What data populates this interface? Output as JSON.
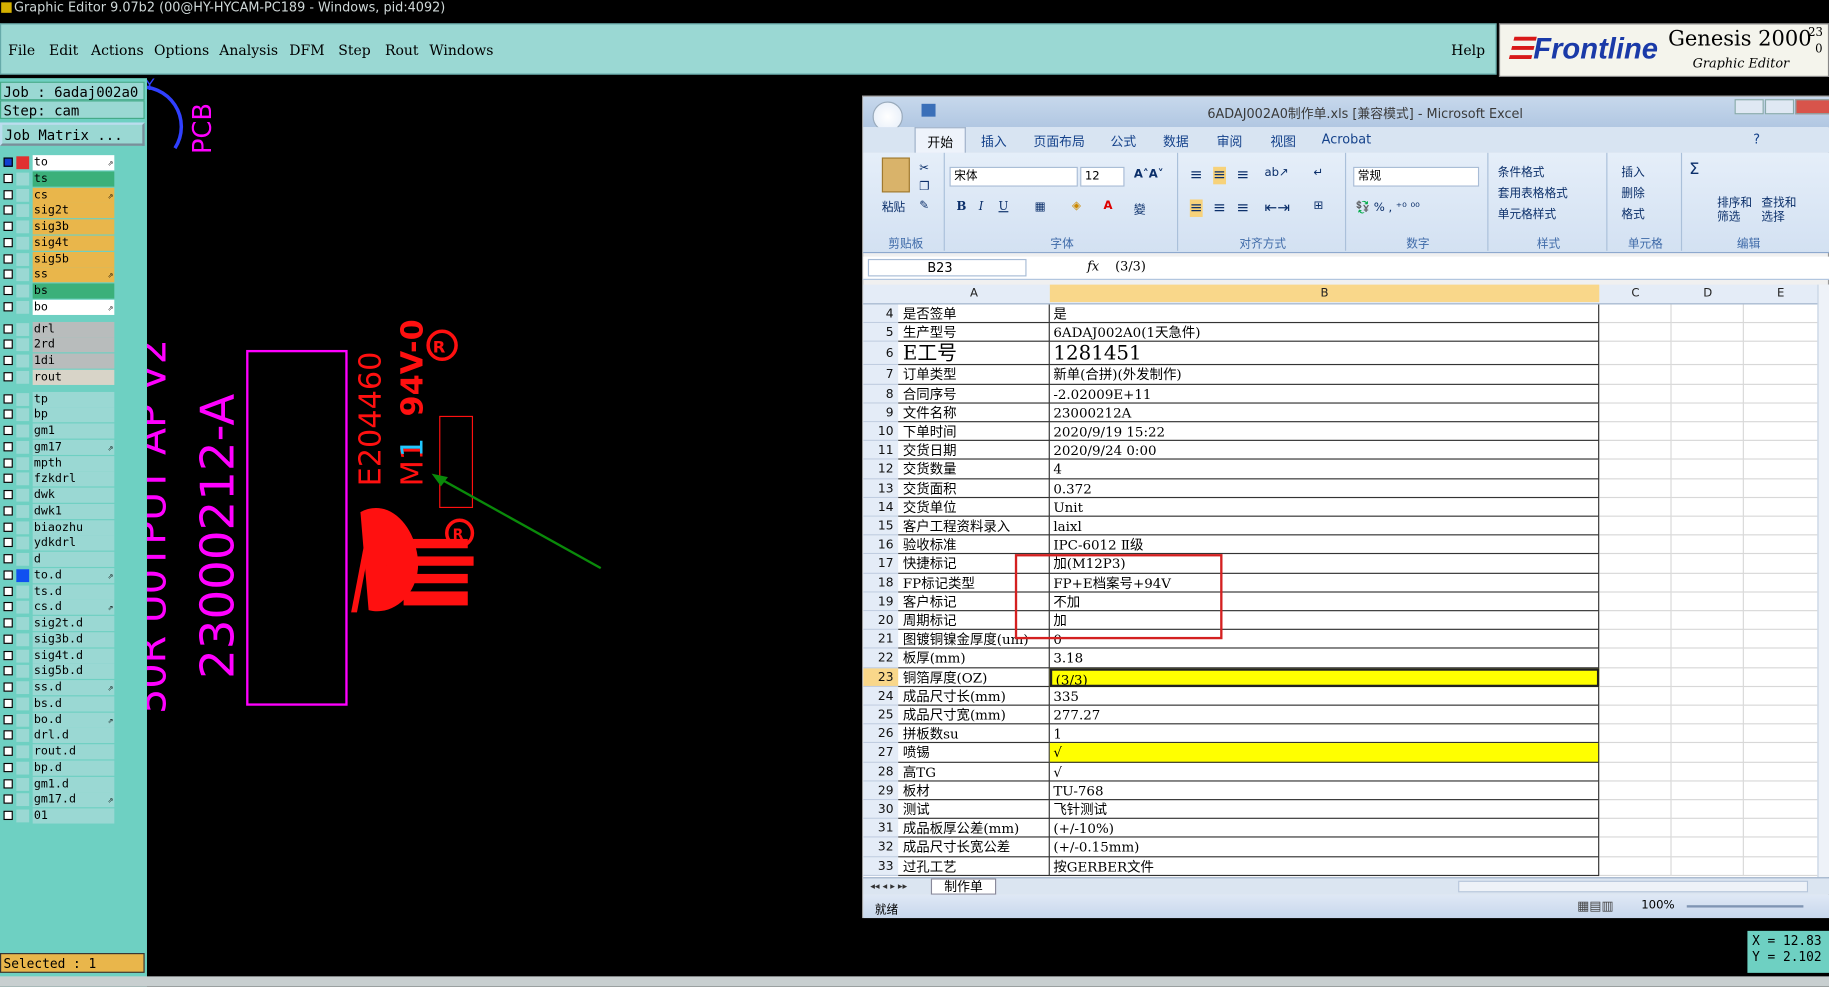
{
  "genesis": {
    "title": "Graphic Editor 9.07b2 (00@HY-HYCAM-PC189 - Windows, pid:4092)",
    "menu": [
      "File",
      "Edit",
      "Actions",
      "Options",
      "Analysis",
      "DFM",
      "Step",
      "Rout",
      "Windows"
    ],
    "help": "Help",
    "brand": {
      "frontline": "Frontline",
      "genesis": "Genesis 2000",
      "editor": "Graphic Editor",
      "version_top": "23",
      "version_bottom": "0"
    },
    "job": "Job : 6adaj002a0",
    "step": "Step: cam",
    "job_matrix": "Job Matrix ...",
    "layers": [
      {
        "name": "to",
        "color": "#ffffff",
        "arrow": "⇗"
      },
      {
        "name": "ts",
        "color": "#3bb07a",
        "arrow": ""
      },
      {
        "name": "cs",
        "color": "#e9b64b",
        "arrow": "⇗"
      },
      {
        "name": "sig2t",
        "color": "#e9b64b",
        "arrow": ""
      },
      {
        "name": "sig3b",
        "color": "#e9b64b",
        "arrow": ""
      },
      {
        "name": "sig4t",
        "color": "#e9b64b",
        "arrow": ""
      },
      {
        "name": "sig5b",
        "color": "#e9b64b",
        "arrow": ""
      },
      {
        "name": "ss",
        "color": "#e9b64b",
        "arrow": "⇗"
      },
      {
        "name": "bs",
        "color": "#3bb07a",
        "arrow": ""
      },
      {
        "name": "bo",
        "color": "#ffffff",
        "arrow": "⇗"
      },
      {
        "name": "drl",
        "color": "#b8bcbc",
        "arrow": ""
      },
      {
        "name": "2rd",
        "color": "#b8bcbc",
        "arrow": ""
      },
      {
        "name": "1di",
        "color": "#b8bcbc",
        "arrow": ""
      },
      {
        "name": "rout",
        "color": "#d8d4c8",
        "arrow": ""
      },
      {
        "name": "tp",
        "color": "#9ad8d3",
        "arrow": ""
      },
      {
        "name": "bp",
        "color": "#9ad8d3",
        "arrow": ""
      },
      {
        "name": "gm1",
        "color": "#9ad8d3",
        "arrow": ""
      },
      {
        "name": "gm17",
        "color": "#9ad8d3",
        "arrow": "⇗"
      },
      {
        "name": "mpth",
        "color": "#9ad8d3",
        "arrow": ""
      },
      {
        "name": "fzkdrl",
        "color": "#9ad8d3",
        "arrow": ""
      },
      {
        "name": "dwk",
        "color": "#9ad8d3",
        "arrow": ""
      },
      {
        "name": "dwk1",
        "color": "#9ad8d3",
        "arrow": ""
      },
      {
        "name": "biaozhu",
        "color": "#9ad8d3",
        "arrow": ""
      },
      {
        "name": "ydkdrl",
        "color": "#9ad8d3",
        "arrow": ""
      },
      {
        "name": "d",
        "color": "#9ad8d3",
        "arrow": ""
      },
      {
        "name": "to.d",
        "color": "#9ad8d3",
        "arrow": "⇗"
      },
      {
        "name": "ts.d",
        "color": "#9ad8d3",
        "arrow": ""
      },
      {
        "name": "cs.d",
        "color": "#9ad8d3",
        "arrow": "⇗"
      },
      {
        "name": "sig2t.d",
        "color": "#9ad8d3",
        "arrow": ""
      },
      {
        "name": "sig3b.d",
        "color": "#9ad8d3",
        "arrow": ""
      },
      {
        "name": "sig4t.d",
        "color": "#9ad8d3",
        "arrow": ""
      },
      {
        "name": "sig5b.d",
        "color": "#9ad8d3",
        "arrow": ""
      },
      {
        "name": "ss.d",
        "color": "#9ad8d3",
        "arrow": "⇗"
      },
      {
        "name": "bs.d",
        "color": "#9ad8d3",
        "arrow": ""
      },
      {
        "name": "bo.d",
        "color": "#9ad8d3",
        "arrow": "⇗"
      },
      {
        "name": "drl.d",
        "color": "#9ad8d3",
        "arrow": ""
      },
      {
        "name": "rout.d",
        "color": "#9ad8d3",
        "arrow": ""
      },
      {
        "name": "bp.d",
        "color": "#9ad8d3",
        "arrow": ""
      },
      {
        "name": "gm1.d",
        "color": "#9ad8d3",
        "arrow": ""
      },
      {
        "name": "gm17.d",
        "color": "#9ad8d3",
        "arrow": "⇗"
      },
      {
        "name": "01",
        "color": "#9ad8d3",
        "arrow": ""
      }
    ],
    "selected": "Selected : 1",
    "coords": {
      "x": "X = 12.83",
      "y": "Y = 2.102"
    },
    "canvas": {
      "pcb": "PCB",
      "job_text": "23000212-A",
      "partial_text": "50R U0TPUT AP V2",
      "ul": "E204460",
      "grade": "94V-0",
      "date_code_a": "M1",
      "date_code_b": "1"
    }
  },
  "excel": {
    "title": "6ADAJ002A0制作单.xls [兼容模式] - Microsoft Excel",
    "tabs": [
      "开始",
      "插入",
      "页面布局",
      "公式",
      "数据",
      "审阅",
      "视图",
      "Acrobat"
    ],
    "ribbon": {
      "paste": "粘贴",
      "clipboard": "剪贴板",
      "font": "宋体",
      "size": "12",
      "font_group": "字体",
      "align_group": "对齐方式",
      "number_format": "常规",
      "number_group": "数字",
      "styles": [
        "条件格式",
        "套用表格格式",
        "单元格样式"
      ],
      "styles_group": "样式",
      "cells": [
        "插入",
        "删除",
        "格式"
      ],
      "cells_group": "单元格",
      "sort": "排序和\n筛选",
      "find": "查找和\n选择",
      "edit_group": "编辑"
    },
    "namebox": "B23",
    "fx": "fx",
    "formula": " (3/3)",
    "columns": [
      "A",
      "B",
      "C",
      "D",
      "E"
    ],
    "rows": [
      {
        "n": "4",
        "a": "是否签单",
        "b": "是",
        "hl": false
      },
      {
        "n": "5",
        "a": "生产型号",
        "b": "6ADAJ002A0(1天急件)",
        "hl": false
      },
      {
        "n": "6",
        "a": "E工号",
        "b": "1281451",
        "hl": false,
        "big": true
      },
      {
        "n": "7",
        "a": "订单类型",
        "b": "新单(合拼)(外发制作)",
        "hl": false
      },
      {
        "n": "8",
        "a": "合同序号",
        "b": "-2.02009E+11",
        "hl": false
      },
      {
        "n": "9",
        "a": "文件名称",
        "b": "23000212A",
        "hl": false
      },
      {
        "n": "10",
        "a": "下单时间",
        "b": "2020/9/19 15:22",
        "hl": false
      },
      {
        "n": "11",
        "a": "交货日期",
        "b": "2020/9/24 0:00",
        "hl": false
      },
      {
        "n": "12",
        "a": "交货数量",
        "b": "4",
        "hl": false
      },
      {
        "n": "13",
        "a": "交货面积",
        "b": "0.372",
        "hl": false
      },
      {
        "n": "14",
        "a": "交货单位",
        "b": "Unit",
        "hl": false
      },
      {
        "n": "15",
        "a": "客户工程资料录入",
        "b": "laixl",
        "hl": false
      },
      {
        "n": "16",
        "a": "验收标准",
        "b": "IPC-6012 Ⅱ级",
        "hl": false
      },
      {
        "n": "17",
        "a": "快捷标记",
        "b": "加(M12P3)",
        "hl": false
      },
      {
        "n": "18",
        "a": "FP标记类型",
        "b": "FP+E档案号+94V",
        "hl": false
      },
      {
        "n": "19",
        "a": "客户标记",
        "b": "不加",
        "hl": false
      },
      {
        "n": "20",
        "a": "周期标记",
        "b": "加",
        "hl": false
      },
      {
        "n": "21",
        "a": "图镀铜镍金厚度(um)",
        "b": "0",
        "hl": false
      },
      {
        "n": "22",
        "a": "板厚(mm)",
        "b": "3.18",
        "hl": false
      },
      {
        "n": "23",
        "a": "铜箔厚度(OZ)",
        "b": " (3/3)",
        "hl": true
      },
      {
        "n": "24",
        "a": "成品尺寸长(mm)",
        "b": "335",
        "hl": false
      },
      {
        "n": "25",
        "a": "成品尺寸宽(mm)",
        "b": "277.27",
        "hl": false
      },
      {
        "n": "26",
        "a": "拼板数su",
        "b": "1",
        "hl": false
      },
      {
        "n": "27",
        "a": "喷锡",
        "b": "√",
        "hl": true
      },
      {
        "n": "28",
        "a": "高TG",
        "b": "√",
        "hl": false
      },
      {
        "n": "29",
        "a": "板材",
        "b": "TU-768",
        "hl": false
      },
      {
        "n": "30",
        "a": "测试",
        "b": "飞针测试",
        "hl": false
      },
      {
        "n": "31",
        "a": "成品板厚公差(mm)",
        "b": "(+/-10%)",
        "hl": false
      },
      {
        "n": "32",
        "a": "成品尺寸长宽公差",
        "b": "(+/-0.15mm)",
        "hl": false
      },
      {
        "n": "33",
        "a": "过孔工艺",
        "b": "按GERBER文件",
        "hl": false
      }
    ],
    "sheet": "制作单",
    "status": "就绪",
    "zoom": "100%",
    "highlight_color": "#ffff00",
    "annotation_color": "#d42020"
  }
}
